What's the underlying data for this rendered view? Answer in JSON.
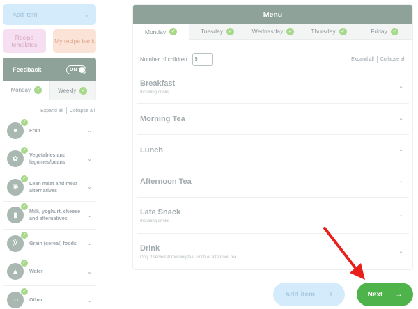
{
  "sidebar": {
    "add_item": {
      "label": "Add item",
      "icon": "chevron-down-icon"
    },
    "tiles": {
      "recipe_templates": "Recipe templates",
      "recipe_bank": "My recipe bank"
    },
    "feedback": {
      "title": "Feedback",
      "toggle_label": "ON",
      "tabs": [
        {
          "label": "Monday",
          "checked": true
        },
        {
          "label": "Weekly",
          "checked": true
        }
      ],
      "expand_all": "Expand all",
      "collapse_all": "Collapse all",
      "food_groups": [
        {
          "label": "Fruit",
          "icon": "apple-icon"
        },
        {
          "label": "Vegetables and legumes/beans",
          "icon": "vegetables-icon"
        },
        {
          "label": "Lean meat and meat alternatives",
          "icon": "meat-icon"
        },
        {
          "label": "Milk, yoghurt, cheese and alternatives",
          "icon": "dairy-icon"
        },
        {
          "label": "Grain (cereal) foods",
          "icon": "grain-icon"
        },
        {
          "label": "Water",
          "icon": "water-drop-icon"
        },
        {
          "label": "Other",
          "icon": "more-icon"
        }
      ]
    }
  },
  "menu": {
    "title": "Menu",
    "days": [
      {
        "label": "Monday",
        "checked": true
      },
      {
        "label": "Tuesday",
        "checked": true
      },
      {
        "label": "Wednesday",
        "checked": true
      },
      {
        "label": "Thursday",
        "checked": true
      },
      {
        "label": "Friday",
        "checked": true
      }
    ],
    "children_label": "Number of children",
    "children_value": "5",
    "expand_all": "Expand all",
    "collapse_all": "Collapse all",
    "meals": [
      {
        "title": "Breakfast",
        "subtitle": "Including drinks"
      },
      {
        "title": "Morning Tea",
        "subtitle": ""
      },
      {
        "title": "Lunch",
        "subtitle": ""
      },
      {
        "title": "Afternoon Tea",
        "subtitle": ""
      },
      {
        "title": "Late Snack",
        "subtitle": "Including drinks"
      },
      {
        "title": "Drink",
        "subtitle": "Only if served at morning tea, lunch or afternoon tea"
      }
    ]
  },
  "actions": {
    "add_item": "Add item",
    "add_icon": "+",
    "next": "Next",
    "next_icon": "→"
  },
  "colors": {
    "header": "#8fa29a",
    "check": "#a8d88b",
    "next_button": "#4fb34b",
    "add_button": "#d3ebfb",
    "annotation_arrow": "#e8201c"
  }
}
